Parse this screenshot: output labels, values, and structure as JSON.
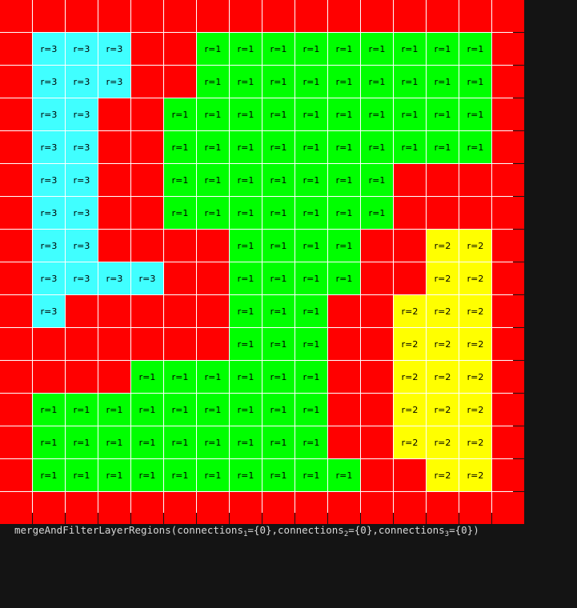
{
  "grid": {
    "colors": {
      "0": "#ff0000",
      "1": "#00ff00",
      "2": "#ffff00",
      "3": "#40ffff"
    },
    "labels": {
      "0": "",
      "1": "r=1",
      "2": "r=2",
      "3": "r=3"
    },
    "rows": [
      "0000000000000000",
      "0333001111111110",
      "0333001111111110",
      "0330011111111110",
      "0330011111111110",
      "0330011111110000",
      "0330011111110000",
      "0330000111100220",
      "0333300111100220",
      "0300000111002220",
      "0000000111002220",
      "0000111111002220",
      "0111111111002220",
      "0111111111002220",
      "0111111111100220",
      "0000000000000000"
    ]
  },
  "caption": {
    "prefix": "mergeAndFilterLayerRegions(connections",
    "sub1": "1",
    "mid1": "={0},connections",
    "sub2": "2",
    "mid2": "={0},connections",
    "sub3": "3",
    "suffix": "={0})"
  }
}
